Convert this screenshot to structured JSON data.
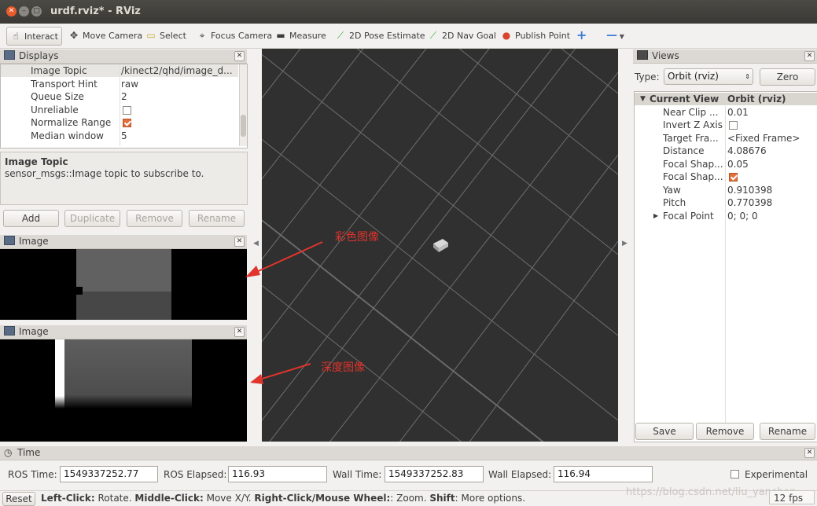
{
  "window": {
    "title": "urdf.rviz* - RViz"
  },
  "toolbar": {
    "interact": "Interact",
    "move_camera": "Move Camera",
    "select": "Select",
    "focus_camera": "Focus Camera",
    "measure": "Measure",
    "pose_estimate": "2D Pose Estimate",
    "nav_goal": "2D Nav Goal",
    "publish_point": "Publish Point"
  },
  "displays": {
    "title": "Displays",
    "rows": [
      {
        "key": "Image Topic",
        "value": "/kinect2/qhd/image_d..."
      },
      {
        "key": "Transport Hint",
        "value": "raw"
      },
      {
        "key": "Queue Size",
        "value": "2"
      },
      {
        "key": "Unreliable",
        "value": ""
      },
      {
        "key": "Normalize Range",
        "value": ""
      },
      {
        "key": "Median window",
        "value": "5"
      }
    ],
    "description_title": "Image Topic",
    "description_text": "sensor_msgs::Image topic to subscribe to.",
    "buttons": {
      "add": "Add",
      "duplicate": "Duplicate",
      "remove": "Remove",
      "rename": "Rename"
    }
  },
  "image_panel_1": {
    "title": "Image"
  },
  "image_panel_2": {
    "title": "Image"
  },
  "annotations": {
    "color_image": "彩色图像",
    "depth_image": "深度图像"
  },
  "views": {
    "title": "Views",
    "type_label": "Type:",
    "type_value": "Orbit (rviz)",
    "zero": "Zero",
    "header_key": "Current View",
    "header_value": "Orbit (rviz)",
    "rows": [
      {
        "key": "Near Clip ...",
        "value": "0.01"
      },
      {
        "key": "Invert Z Axis",
        "value": ""
      },
      {
        "key": "Target Fra...",
        "value": "<Fixed Frame>"
      },
      {
        "key": "Distance",
        "value": "4.08676"
      },
      {
        "key": "Focal Shap...",
        "value": "0.05"
      },
      {
        "key": "Focal Shap...",
        "value": ""
      },
      {
        "key": "Yaw",
        "value": "0.910398"
      },
      {
        "key": "Pitch",
        "value": "0.770398"
      },
      {
        "key": "Focal Point",
        "value": "0; 0; 0"
      }
    ],
    "buttons": {
      "save": "Save",
      "remove": "Remove",
      "rename": "Rename"
    }
  },
  "time": {
    "title": "Time",
    "ros_time_label": "ROS Time:",
    "ros_time": "1549337252.77",
    "ros_elapsed_label": "ROS Elapsed:",
    "ros_elapsed": "116.93",
    "wall_time_label": "Wall Time:",
    "wall_time": "1549337252.83",
    "wall_elapsed_label": "Wall Elapsed:",
    "wall_elapsed": "116.94",
    "experimental": "Experimental"
  },
  "status": {
    "reset": "Reset",
    "left_click": "Left-Click:",
    "left_desc": " Rotate. ",
    "middle_click": "Middle-Click:",
    "middle_desc": " Move X/Y. ",
    "right_click": "Right-Click/Mouse Wheel:",
    "right_desc": ": Zoom. ",
    "shift": "Shift",
    "shift_desc": ": More options.",
    "watermark": "https://blog.csdn.net/liu_yanchen",
    "fps": "12 fps"
  },
  "colors": {
    "accent": "#e36f3a",
    "viewport_bg": "#303030",
    "annotation": "#e0342c"
  }
}
